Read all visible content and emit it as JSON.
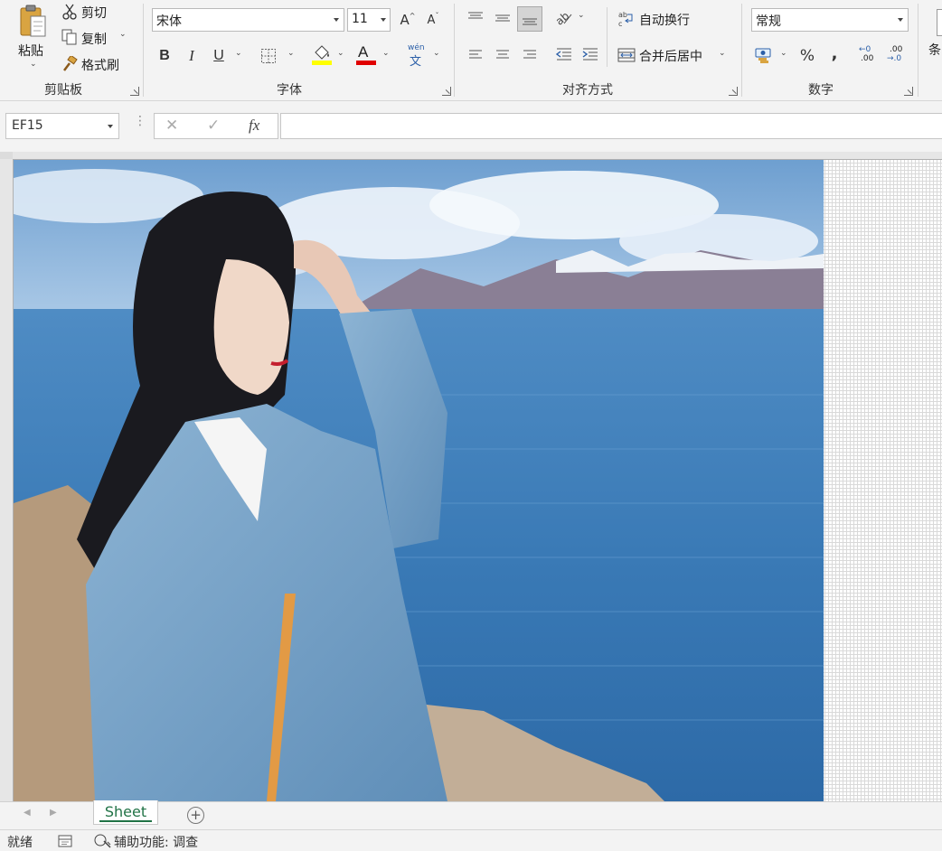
{
  "ribbon": {
    "clipboard": {
      "paste_label": "粘贴",
      "cut_label": "剪切",
      "copy_label": "复制",
      "format_painter_label": "格式刷",
      "group_label": "剪贴板"
    },
    "font": {
      "font_name": "宋体",
      "font_size": "11",
      "bold": "B",
      "italic": "I",
      "underline": "U",
      "increase_size": "A",
      "decrease_size": "A",
      "phonetic_top": "wén",
      "phonetic_bottom": "文",
      "group_label": "字体",
      "fill_color": "#ffff00",
      "font_color": "#e00000"
    },
    "alignment": {
      "wrap_text_label": "自动换行",
      "merge_center_label": "合并后居中",
      "group_label": "对齐方式"
    },
    "number": {
      "format": "常规",
      "percent": "%",
      "comma": ",",
      "increase_decimal_top": "←0",
      "increase_decimal_bottom": ".00",
      "decrease_decimal_top": ".00",
      "decrease_decimal_bottom": "→.0",
      "group_label": "数字"
    },
    "conditional_cut_label": "条"
  },
  "formula_bar": {
    "name_box": "EF15",
    "cancel": "✕",
    "enter": "✓",
    "fx": "fx",
    "formula": ""
  },
  "sheet_tabs": [
    {
      "label": "Sheet",
      "active": true
    }
  ],
  "add_sheet": "+",
  "status_bar": {
    "ready": "就绪",
    "accessibility": "辅助功能: 调查"
  },
  "colors": {
    "accent_green": "#217346",
    "ribbon_bg": "#f3f3f3"
  }
}
